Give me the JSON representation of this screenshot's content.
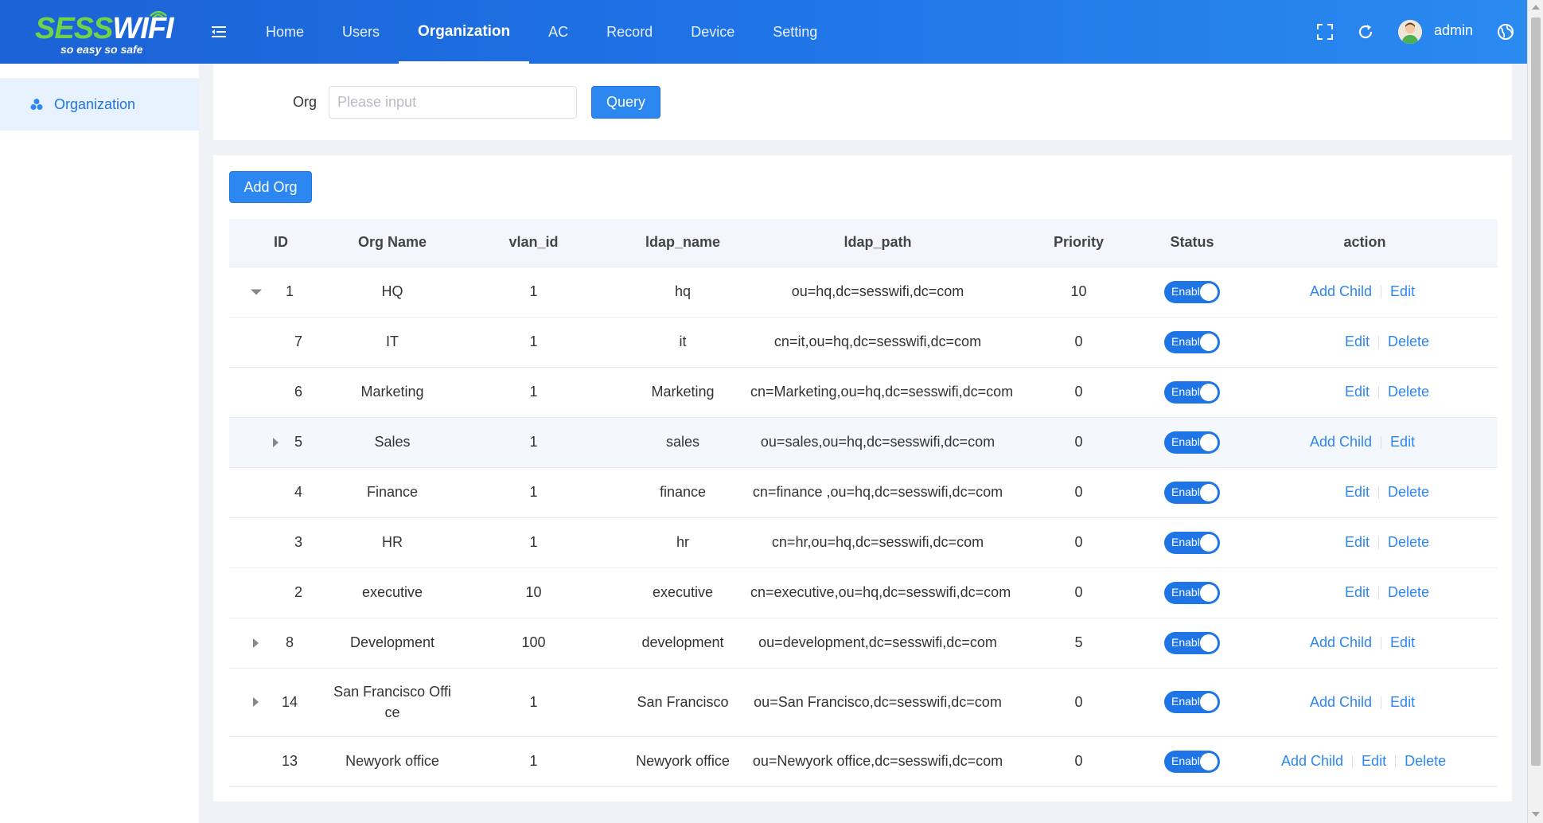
{
  "brand": {
    "logo_part1": "SESS",
    "logo_part2": "WIFI",
    "tagline": "so easy so safe"
  },
  "nav": {
    "items": [
      {
        "label": "Home"
      },
      {
        "label": "Users"
      },
      {
        "label": "Organization",
        "active": true
      },
      {
        "label": "AC"
      },
      {
        "label": "Record"
      },
      {
        "label": "Device"
      },
      {
        "label": "Setting"
      }
    ]
  },
  "header": {
    "username": "admin"
  },
  "sidebar": {
    "items": [
      {
        "label": "Organization",
        "icon": "org-icon"
      }
    ]
  },
  "query": {
    "label": "Org",
    "placeholder": "Please input",
    "value": "",
    "button": "Query"
  },
  "table": {
    "add_button": "Add Org",
    "columns": [
      "ID",
      "Org Name",
      "vlan_id",
      "ldap_name",
      "ldap_path",
      "Priority",
      "Status",
      "action"
    ],
    "status_text": "Enable",
    "rows": [
      {
        "id": "1",
        "name": "HQ",
        "vlan": "1",
        "ldap_name": "hq",
        "ldap_path": "ou=hq,dc=sesswifi,dc=com",
        "priority": "10",
        "actions": [
          "Add Child",
          "Edit"
        ]
      },
      {
        "id": "7",
        "name": "IT",
        "vlan": "1",
        "ldap_name": "it",
        "ldap_path": "cn=it,ou=hq,dc=sesswifi,dc=com",
        "priority": "0",
        "actions": [
          "Edit",
          "Delete"
        ]
      },
      {
        "id": "6",
        "name": "Marketing",
        "vlan": "1",
        "ldap_name": "Marketing",
        "ldap_path": "cn=Marketing,ou=hq,dc=sesswifi,dc=com",
        "priority": "0",
        "actions": [
          "Edit",
          "Delete"
        ]
      },
      {
        "id": "5",
        "name": "Sales",
        "vlan": "1",
        "ldap_name": "sales",
        "ldap_path": "ou=sales,ou=hq,dc=sesswifi,dc=com",
        "priority": "0",
        "actions": [
          "Add Child",
          "Edit"
        ]
      },
      {
        "id": "4",
        "name": "Finance",
        "vlan": "1",
        "ldap_name": "finance",
        "ldap_path": "cn=finance ,ou=hq,dc=sesswifi,dc=com",
        "priority": "0",
        "actions": [
          "Edit",
          "Delete"
        ]
      },
      {
        "id": "3",
        "name": "HR",
        "vlan": "1",
        "ldap_name": "hr",
        "ldap_path": "cn=hr,ou=hq,dc=sesswifi,dc=com",
        "priority": "0",
        "actions": [
          "Edit",
          "Delete"
        ]
      },
      {
        "id": "2",
        "name": "executive",
        "vlan": "10",
        "ldap_name": "executive",
        "ldap_path": "cn=executive,ou=hq,dc=sesswifi,dc=com",
        "priority": "0",
        "actions": [
          "Edit",
          "Delete"
        ]
      },
      {
        "id": "8",
        "name": "Development",
        "vlan": "100",
        "ldap_name": "development",
        "ldap_path": "ou=development,dc=sesswifi,dc=com",
        "priority": "5",
        "actions": [
          "Add Child",
          "Edit"
        ]
      },
      {
        "id": "14",
        "name": "San Francisco Office",
        "vlan": "1",
        "ldap_name": "San Francisco",
        "ldap_path": "ou=San Francisco,dc=sesswifi,dc=com",
        "priority": "0",
        "actions": [
          "Add Child",
          "Edit"
        ]
      },
      {
        "id": "13",
        "name": "Newyork office",
        "vlan": "1",
        "ldap_name": "Newyork office",
        "ldap_path": "ou=Newyork office,dc=sesswifi,dc=com",
        "priority": "0",
        "actions": [
          "Add Child",
          "Edit",
          "Delete"
        ]
      }
    ]
  }
}
